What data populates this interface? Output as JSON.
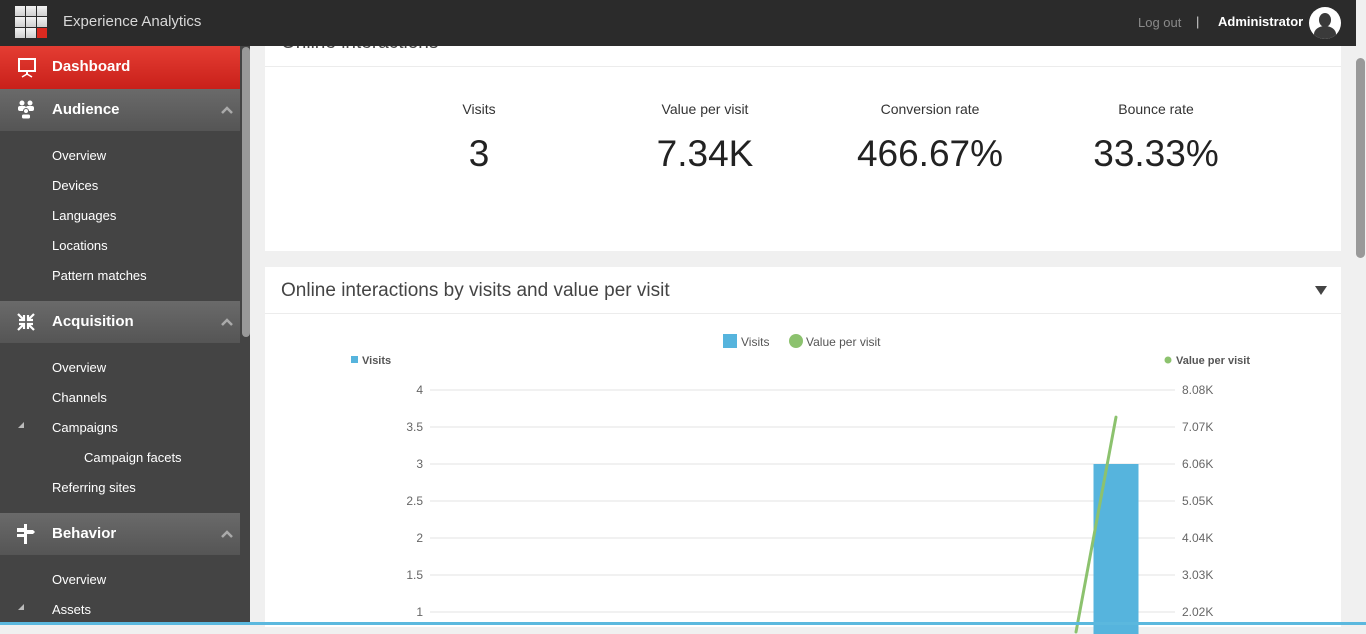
{
  "header": {
    "app_title": "Experience Analytics",
    "logout_label": "Log out",
    "separator": "|",
    "user_name": "Administrator"
  },
  "sidebar": {
    "dashboard": {
      "label": "Dashboard",
      "icon": "presentation-board-icon",
      "active": true
    },
    "sections": [
      {
        "label": "Audience",
        "icon": "people-group-icon",
        "expanded": true,
        "items": [
          {
            "label": "Overview"
          },
          {
            "label": "Devices"
          },
          {
            "label": "Languages"
          },
          {
            "label": "Locations"
          },
          {
            "label": "Pattern matches"
          }
        ]
      },
      {
        "label": "Acquisition",
        "icon": "arrows-inward-icon",
        "expanded": true,
        "items": [
          {
            "label": "Overview"
          },
          {
            "label": "Channels"
          },
          {
            "label": "Campaigns",
            "expanded": true,
            "children": [
              {
                "label": "Campaign facets"
              }
            ]
          },
          {
            "label": "Referring sites"
          }
        ]
      },
      {
        "label": "Behavior",
        "icon": "signpost-icon",
        "expanded": true,
        "items": [
          {
            "label": "Overview"
          },
          {
            "label": "Assets",
            "expanded": true
          }
        ]
      }
    ]
  },
  "kpi_panel": {
    "title": "Online interactions",
    "kpis": [
      {
        "label": "Visits",
        "value": "3"
      },
      {
        "label": "Value per visit",
        "value": "7.34K"
      },
      {
        "label": "Conversion rate",
        "value": "466.67%"
      },
      {
        "label": "Bounce rate",
        "value": "33.33%"
      }
    ]
  },
  "chart_panel": {
    "title": "Online interactions by visits and value per visit"
  },
  "chart_data": {
    "type": "bar",
    "title": "Online interactions by visits and value per visit",
    "legend": [
      "Visits",
      "Value per visit"
    ],
    "legend_position": "top-center",
    "colors": {
      "visits": "#56b4dd",
      "value_per_visit": "#8cc26e"
    },
    "left_axis": {
      "label": "Visits",
      "ticks": [
        "4",
        "3.5",
        "3",
        "2.5",
        "2",
        "1.5",
        "1"
      ],
      "range": [
        1,
        4
      ]
    },
    "right_axis": {
      "label": "Value per visit",
      "ticks": [
        "8.08K",
        "7.07K",
        "6.06K",
        "5.05K",
        "4.04K",
        "3.03K",
        "2.02K"
      ],
      "range": [
        2020,
        8080
      ]
    },
    "grid": true,
    "series": [
      {
        "name": "Visits",
        "type": "bar",
        "axis": "left",
        "values": [
          3
        ]
      },
      {
        "name": "Value per visit",
        "type": "line",
        "axis": "right",
        "values": [
          7340
        ],
        "note": "line rises steeply from below visible range to the last point"
      }
    ]
  }
}
